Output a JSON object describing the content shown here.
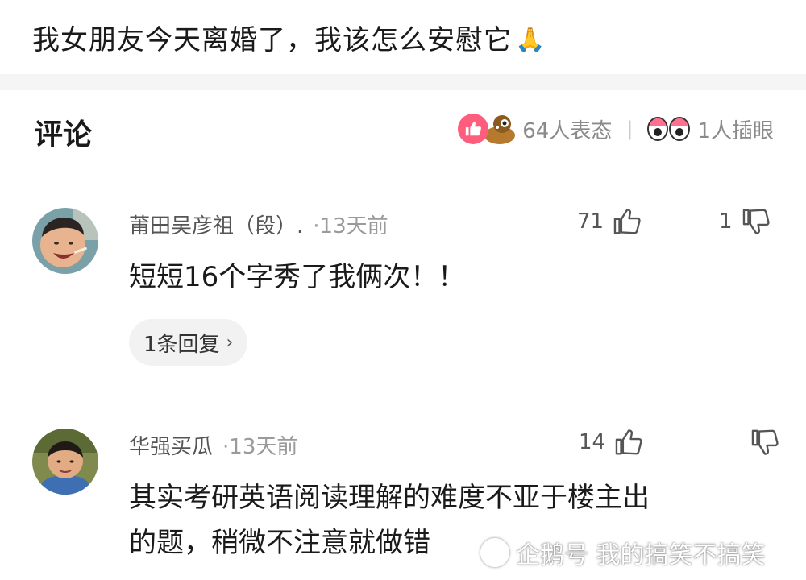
{
  "post": {
    "title": "我女朋友今天离婚了，我该怎么安慰它",
    "emoji": "🙏"
  },
  "comments_header": {
    "heading": "评论",
    "reactions_count": "64人表态",
    "eyes_count": "1人插眼"
  },
  "comments": [
    {
      "username": "莆田吴彦祖（段）.",
      "time": "·13天前",
      "likes": "71",
      "dislikes": "1",
      "text": "短短16个字秀了我俩次！！",
      "reply_label": "1条回复",
      "reply_chevron": "›"
    },
    {
      "username": "华强买瓜",
      "time": "·13天前",
      "likes": "14",
      "dislikes": "",
      "text_line1": "其实考研英语阅读理解的难度不亚于楼主出",
      "text_line2": "的题，稍微不注意就做错"
    }
  ],
  "watermark": "企鹅号 我的搞笑不搞笑",
  "colors": {
    "like_bubble": "#ff5d7d",
    "band": "#f5f5f5",
    "muted_text": "#9a9a9a"
  }
}
